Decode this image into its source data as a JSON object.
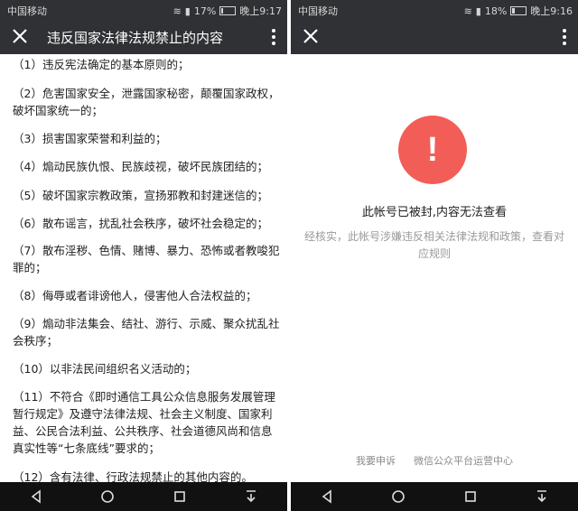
{
  "left_screen": {
    "status": {
      "carrier": "中国移动",
      "battery": "17%",
      "time": "晚上9:17",
      "battery_level": 0.17
    },
    "title": "违反国家法律法规禁止的内容",
    "items": [
      "（1）违反宪法确定的基本原则的；",
      "（2）危害国家安全，泄露国家秘密，颠覆国家政权，破坏国家统一的；",
      "（3）损害国家荣誉和利益的；",
      "（4）煽动民族仇恨、民族歧视，破坏民族团结的；",
      "（5）破坏国家宗教政策，宣扬邪教和封建迷信的；",
      "（6）散布谣言，扰乱社会秩序，破坏社会稳定的；",
      "（7）散布淫秽、色情、赌博、暴力、恐怖或者教唆犯罪的；",
      "（8）侮辱或者诽谤他人，侵害他人合法权益的；",
      "（9）煽动非法集会、结社、游行、示威、聚众扰乱社会秩序；",
      "（10）以非法民间组织名义活动的；",
      "（11）不符合《即时通信工具公众信息服务发展管理暂行规定》及遵守法律法规、社会主义制度、国家利益、公民合法利益、公共秩序、社会道德风尚和信息真实性等“七条底线”要求的；",
      "（12）含有法律、行政法规禁止的其他内容的。"
    ]
  },
  "right_screen": {
    "status": {
      "carrier": "中国移动",
      "battery": "18%",
      "time": "晚上9:16",
      "battery_level": 0.18
    },
    "alert_symbol": "!",
    "blocked_title": "此帐号已被封,内容无法查看",
    "blocked_desc": "经核实，此帐号涉嫌违反相关法律法规和政策，查看对应规则",
    "footer": {
      "appeal": "我要申诉",
      "center": "微信公众平台运营中心"
    }
  },
  "colors": {
    "bar": "#2f3134",
    "alert": "#f25e57",
    "nav": "#111111"
  },
  "icons": [
    "close-icon",
    "more-icon",
    "back-icon",
    "home-icon",
    "recent-icon",
    "download-icon",
    "wifi-icon",
    "signal-icon",
    "battery-icon"
  ]
}
